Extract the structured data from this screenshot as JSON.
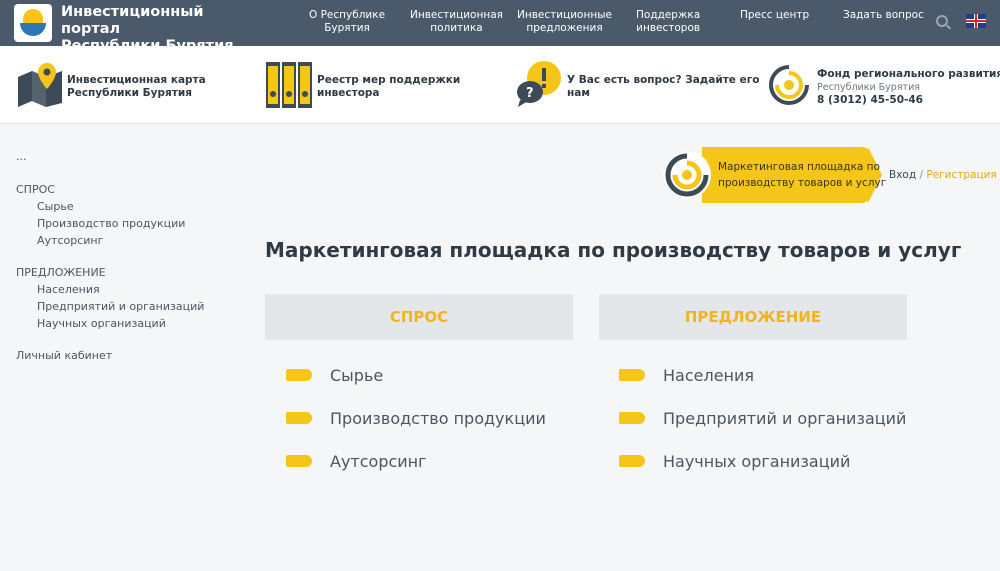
{
  "header": {
    "title_line1": "Инвестиционный портал",
    "title_line2": "Республики Бурятия",
    "nav": [
      {
        "l1": "О Республике",
        "l2": "Бурятия"
      },
      {
        "l1": "Инвестиционная",
        "l2": "политика"
      },
      {
        "l1": "Инвестиционные",
        "l2": "предложения"
      },
      {
        "l1": "Поддержка",
        "l2": "инвесторов"
      },
      {
        "l1": "Пресс центр",
        "l2": ""
      },
      {
        "l1": "Задать вопрос",
        "l2": ""
      }
    ],
    "icons": {
      "search": "search-icon",
      "language": "uk-flag-icon"
    }
  },
  "infobar": {
    "map": {
      "l1": "Инвестиционная карта",
      "l2": "Республики Бурятия",
      "icon": "map-pin-icon"
    },
    "registry": {
      "l1": "Реестр мер поддержки",
      "l2": "инвестора",
      "icon": "binders-icon"
    },
    "question": {
      "l1": "У Вас есть вопрос? Задайте его",
      "l2": "нам",
      "icon": "chat-question-icon"
    },
    "fund": {
      "l1": "Фонд регионального развития",
      "l2": "Республики Бурятия",
      "phone": "8 (3012) 45-50-46",
      "icon": "fund-logo-icon"
    }
  },
  "sidebar": {
    "dots": "...",
    "demand": {
      "head": "СПРОС",
      "items": [
        "Сырье",
        "Производство продукции",
        "Аутсорсинг"
      ]
    },
    "supply": {
      "head": "ПРЕДЛОЖЕНИЕ",
      "items": [
        "Населения",
        "Предприятий и организаций",
        "Научных организаций"
      ]
    },
    "cabinet": "Личный кабинет"
  },
  "banner": {
    "l1": "Маркетинговая площадка по",
    "l2": "производству товаров и услуг"
  },
  "auth": {
    "login": "Вход",
    "sep": "/",
    "register": "Регистрация"
  },
  "main": {
    "title": "Маркетинговая площадка по производству товаров и услуг",
    "demand": {
      "head": "СПРОС",
      "items": [
        "Сырье",
        "Производство продукции",
        "Аутсорсинг"
      ]
    },
    "supply": {
      "head": "ПРЕДЛОЖЕНИЕ",
      "items": [
        "Населения",
        "Предприятий и организаций",
        "Научных организаций"
      ]
    }
  },
  "colors": {
    "topbar": "#4b5a6a",
    "accent": "#f5c518",
    "heading_accent": "#f1b51c",
    "panel": "#e3e7ea"
  }
}
